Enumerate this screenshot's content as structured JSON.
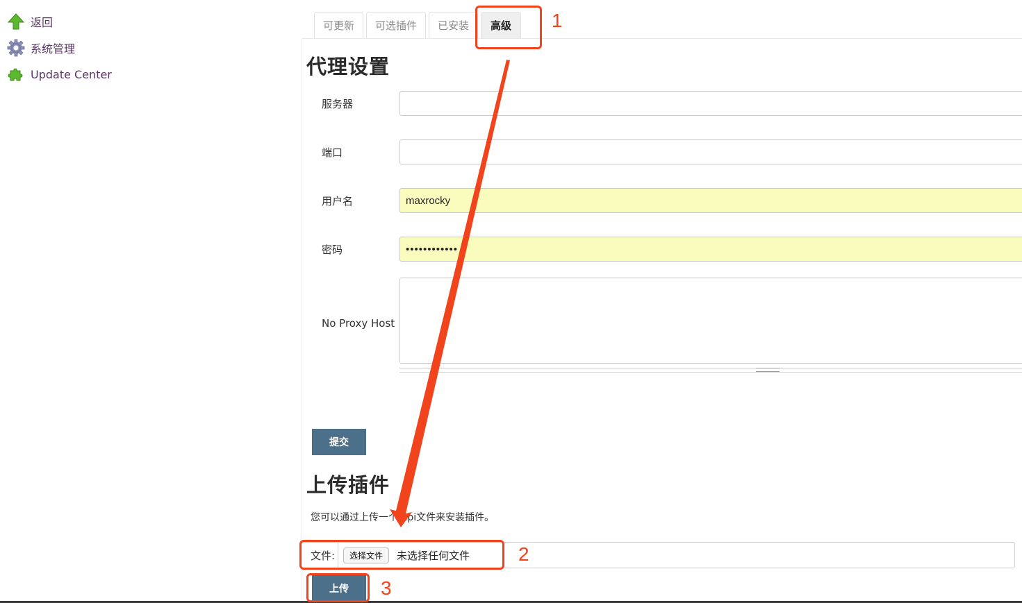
{
  "sidebar": {
    "items": [
      {
        "label": "返回",
        "icon": "up-arrow-icon"
      },
      {
        "label": "系统管理",
        "icon": "gear-icon"
      },
      {
        "label": "Update Center",
        "icon": "puzzle-icon"
      }
    ]
  },
  "tabs": [
    {
      "label": "可更新"
    },
    {
      "label": "可选插件"
    },
    {
      "label": "已安装"
    },
    {
      "label": "高级",
      "active": true
    }
  ],
  "proxy": {
    "title": "代理设置",
    "server_label": "服务器",
    "server_value": "",
    "port_label": "端口",
    "port_value": "",
    "username_label": "用户名",
    "username_value": "maxrocky",
    "password_label": "密码",
    "password_value": "••••••••••••",
    "no_proxy_label": "No Proxy Host",
    "no_proxy_value": "",
    "submit_label": "提交"
  },
  "upload": {
    "title": "上传插件",
    "description": "您可以通过上传一个.hpi文件来安装插件。",
    "file_label": "文件:",
    "choose_label": "选择文件",
    "no_file_text": "未选择任何文件",
    "upload_label": "上传"
  },
  "annotations": {
    "color": "#f2441c",
    "numbers": [
      "1",
      "2",
      "3"
    ]
  },
  "colors": {
    "link": "#5c3566",
    "button": "#4c7089",
    "autofill": "#fafcbe"
  }
}
